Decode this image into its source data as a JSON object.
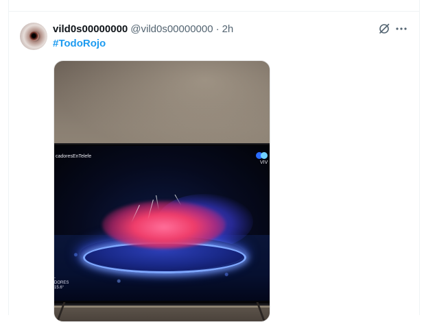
{
  "tweet": {
    "display_name": "vild0s00000000",
    "handle": "@vild0s00000000",
    "separator": "·",
    "time": "2h",
    "hashtag": "#TodoRojo",
    "avatar_icon": "avatar",
    "grok_icon": "grok-icon",
    "more_icon": "more-icon"
  },
  "media": {
    "screen_channel_text": "cadoresEnTelefe",
    "screen_live_text": "VIV",
    "screen_lower_text": "-\nDORES\n15.6°",
    "colors": {
      "smoke": "#ef3d6a",
      "stadium_light": "#2d3fb8",
      "link": "#1d9bf0"
    }
  }
}
